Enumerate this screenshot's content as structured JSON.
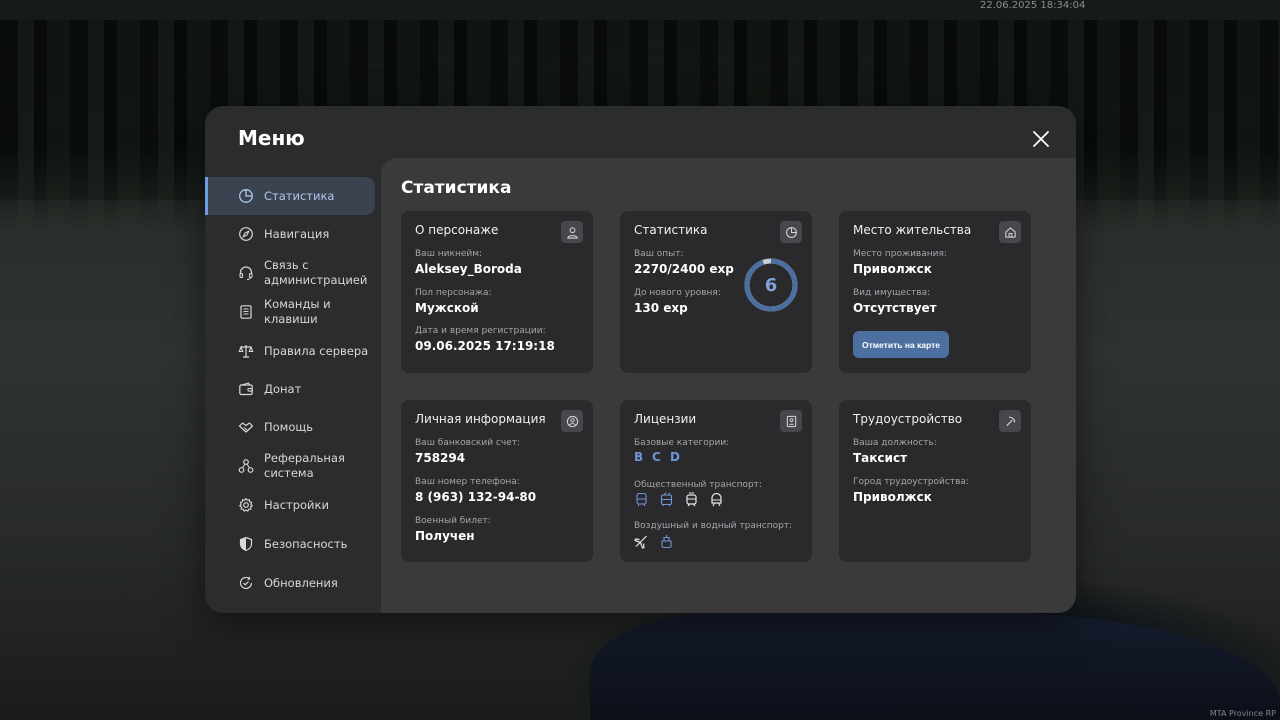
{
  "overlay": {
    "timestamp": "22.06.2025 18:34:04",
    "watermark": "MTA Province RP"
  },
  "menu": {
    "title": "Меню",
    "close_icon": "close-icon"
  },
  "sidebar": {
    "items": [
      {
        "label": "Статистика",
        "icon": "pie-chart-icon",
        "active": true
      },
      {
        "label": "Навигация",
        "icon": "compass-icon"
      },
      {
        "label": "Связь с администрацией",
        "icon": "headset-icon"
      },
      {
        "label": "Команды и клавиши",
        "icon": "document-icon"
      },
      {
        "label": "Правила сервера",
        "icon": "scales-icon"
      },
      {
        "label": "Донат",
        "icon": "wallet-icon"
      },
      {
        "label": "Помощь",
        "icon": "handshake-icon"
      },
      {
        "label": "Реферальная система",
        "icon": "network-icon"
      },
      {
        "label": "Настройки",
        "icon": "gear-icon"
      },
      {
        "label": "Безопасность",
        "icon": "shield-icon"
      },
      {
        "label": "Обновления",
        "icon": "refresh-check-icon"
      }
    ]
  },
  "content": {
    "title": "Статистика",
    "character": {
      "title": "О персонаже",
      "nickname_label": "Ваш никнейм:",
      "nickname": "Aleksey_Boroda",
      "gender_label": "Пол персонажа:",
      "gender": "Мужской",
      "reg_label": "Дата и время регистрации:",
      "reg_date": "09.06.2025 17:19:18"
    },
    "stats": {
      "title": "Статистика",
      "exp_label": "Ваш опыт:",
      "exp": "2270/2400 exp",
      "next_label": "До нового уровня:",
      "next": "130 exp",
      "level": "6",
      "progress": 0.946
    },
    "residence": {
      "title": "Место жительства",
      "place_label": "Место проживания:",
      "place": "Приволжск",
      "property_label": "Вид имущества:",
      "property": "Отсутствует",
      "map_button": "Отметить на карте"
    },
    "personal": {
      "title": "Личная информация",
      "bank_label": "Ваш банковский счет:",
      "bank": "758294",
      "phone_label": "Ваш номер телефона:",
      "phone": "8 (963) 132-94-80",
      "military_label": "Военный билет:",
      "military": "Получен"
    },
    "licenses": {
      "title": "Лицензии",
      "base_label": "Базовые категории:",
      "categories": [
        "B",
        "C",
        "D"
      ],
      "public_label": "Общественный транспорт:",
      "public_icons": [
        "bus-icon",
        "trolleybus-icon",
        "tram-icon",
        "metro-icon"
      ],
      "air_label": "Воздушный и водный транспорт:",
      "air_icons": [
        "plane-icon",
        "boat-icon"
      ]
    },
    "employment": {
      "title": "Трудоустройство",
      "position_label": "Ваша должность:",
      "position": "Таксист",
      "city_label": "Город трудоустройства:",
      "city": "Приволжск"
    }
  },
  "colors": {
    "accent": "#6f95d6",
    "button": "#4d6fa0",
    "modal": "#2b2c2e",
    "content": "#3a3a3c",
    "card": "#2a2a2c"
  }
}
